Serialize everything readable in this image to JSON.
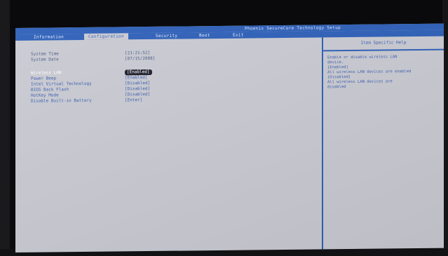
{
  "title": "Phoenix SecureCore Technology Setup",
  "tabs": [
    {
      "label": "Information",
      "active": false
    },
    {
      "label": "Configuration",
      "active": true
    },
    {
      "label": "Security",
      "active": false
    },
    {
      "label": "Boot",
      "active": false
    },
    {
      "label": "Exit",
      "active": false
    }
  ],
  "system": {
    "time_label": "System Time",
    "time_value": "[21:21:52]",
    "date_label": "System Date",
    "date_value": "[07/15/2008]"
  },
  "settings": [
    {
      "label": "Wireless LAN",
      "value": "[Enabled]",
      "selected": true
    },
    {
      "label": "Power Beep",
      "value": "[Enabled]",
      "selected": false
    },
    {
      "label": "Intel Virtual Technology",
      "value": "[Disabled]",
      "selected": false
    },
    {
      "label": "BIOS Back Flash",
      "value": "[Disabled]",
      "selected": false
    },
    {
      "label": "HotKey Mode",
      "value": "[Disabled]",
      "selected": false
    },
    {
      "label": "Disable Built-in Battery",
      "value": "[Enter]",
      "selected": false
    }
  ],
  "help": {
    "header": "Item Specific Help",
    "lines": [
      "Enable or disable wireless LAN",
      "device.",
      "[Enabled]",
      "All wireless LAN devices are enabled",
      "[Disabled]",
      "All wireless LAN devices are",
      "disabled"
    ]
  },
  "colors": {
    "accent": "#2d5fb8",
    "background": "#c9cad2",
    "text": "#3a5eb0",
    "selected_bg": "#1c1c2a"
  }
}
